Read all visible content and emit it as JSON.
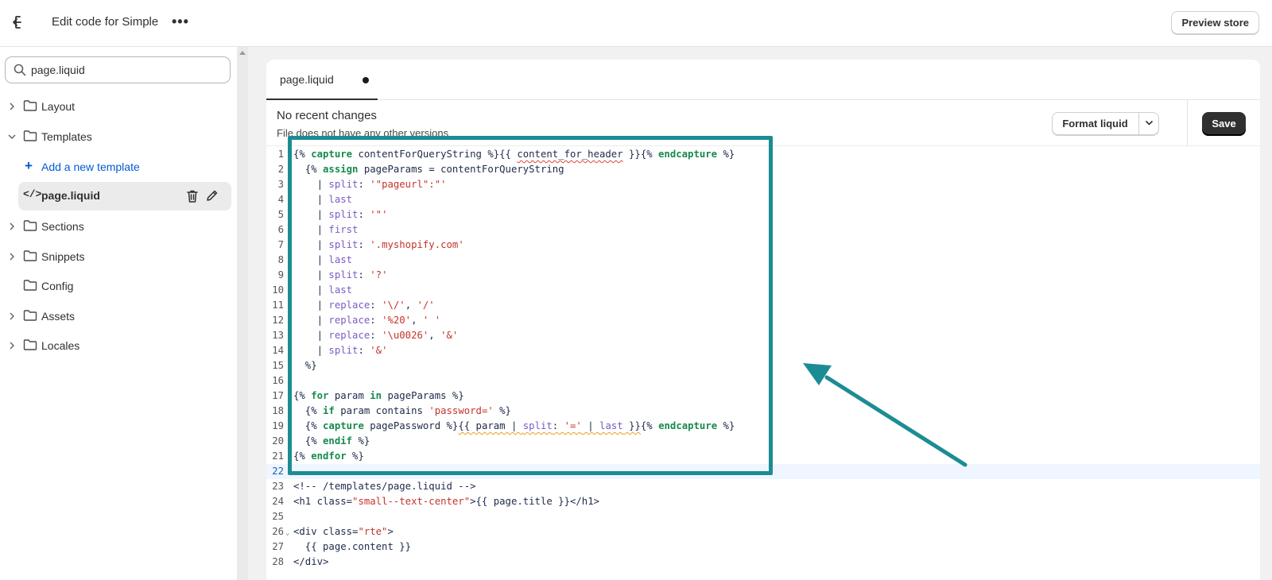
{
  "topbar": {
    "title": "Edit code for Simple",
    "more_label": "•••",
    "preview_label": "Preview store"
  },
  "sidebar": {
    "search_value": "page.liquid",
    "items": [
      {
        "label": "Layout",
        "expanded": false
      },
      {
        "label": "Templates",
        "expanded": true
      },
      {
        "label": "Sections",
        "expanded": false
      },
      {
        "label": "Snippets",
        "expanded": false
      },
      {
        "label": "Config",
        "expanded": false
      },
      {
        "label": "Assets",
        "expanded": false
      },
      {
        "label": "Locales",
        "expanded": false
      }
    ],
    "add_template_label": "Add a new template",
    "active_file": {
      "code_icon": "</>",
      "label": "page.liquid"
    }
  },
  "editor": {
    "tab_label": "page.liquid",
    "tab_unsaved": true,
    "info_title": "No recent changes",
    "info_sub": "File does not have any other versions",
    "format_label": "Format liquid",
    "save_label": "Save",
    "current_line": 22,
    "lines": [
      "{% capture contentForQueryString %}{{ content_for_header }}{% endcapture %}",
      "  {% assign pageParams = contentForQueryString",
      "    | split: '\"pageurl\":\"'",
      "    | last",
      "    | split: '\"'",
      "    | first",
      "    | split: '.myshopify.com'",
      "    | last",
      "    | split: '?'",
      "    | last",
      "    | replace: '\\/', '/'",
      "    | replace: '%20', ' '",
      "    | replace: '\\u0026', '&'",
      "    | split: '&'",
      "  %}",
      "",
      "{% for param in pageParams %}",
      "  {% if param contains 'password=' %}",
      "  {% capture pagePassword %}{{ param | split: '=' | last }}{% endcapture %}",
      "  {% endif %}",
      "{% endfor %}",
      "",
      "<!-- /templates/page.liquid -->",
      "<h1 class=\"small--text-center\">{{ page.title }}</h1>",
      "",
      "<div class=\"rte\">",
      "  {{ page.content }}",
      "</div>"
    ]
  },
  "colors": {
    "highlight": "#1c8c94",
    "save_bg": "#303030",
    "link": "#005bd3"
  }
}
